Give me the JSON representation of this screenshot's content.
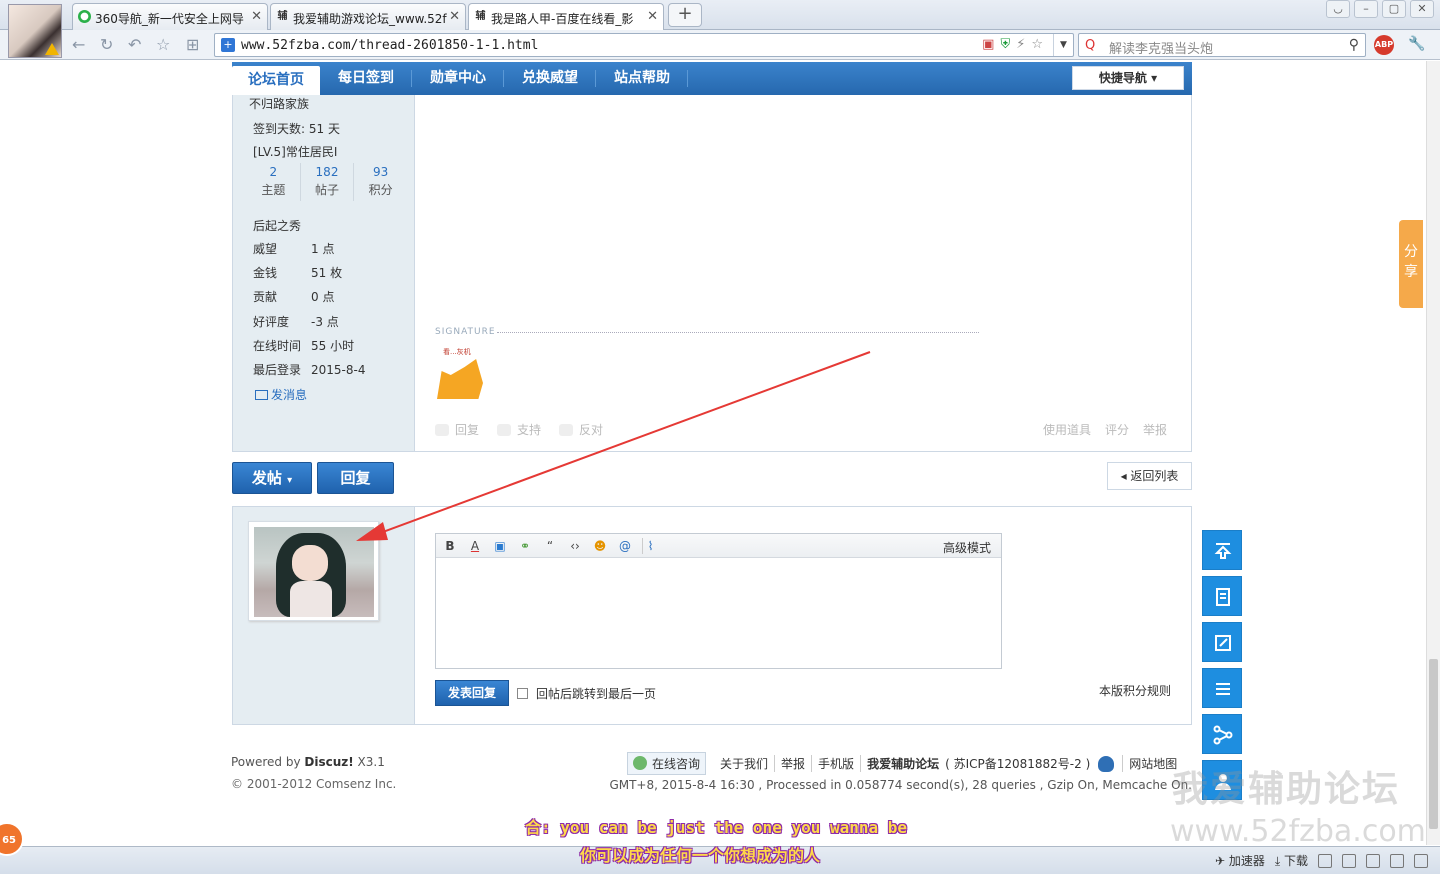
{
  "browser": {
    "tabs": [
      {
        "label": "360导航_新一代安全上网导",
        "icon": "360-icon"
      },
      {
        "label": "我爱辅助游戏论坛_www.52f",
        "icon": "site-icon"
      },
      {
        "label": "我是路人甲-百度在线看_影",
        "icon": "site-icon"
      }
    ],
    "url": "www.52fzba.com/thread-2601850-1-1.html",
    "search_placeholder": "解读李克强当头炮",
    "abp": "ABP"
  },
  "forum_nav": {
    "items": [
      "论坛首页",
      "每日签到",
      "勋章中心",
      "兑换威望",
      "站点帮助"
    ],
    "quick_nav": "快捷导航"
  },
  "profile": {
    "group": "不归路家族",
    "sign_days": "签到天数: 51 天",
    "level": "[LV.5]常住居民I",
    "stats": [
      {
        "num": "2",
        "label": "主题"
      },
      {
        "num": "182",
        "label": "帖子"
      },
      {
        "num": "93",
        "label": "积分"
      }
    ],
    "rank": "后起之秀",
    "fields": [
      {
        "k": "威望",
        "v": "1 点"
      },
      {
        "k": "金钱",
        "v": "51 枚"
      },
      {
        "k": "贡献",
        "v": "0 点"
      },
      {
        "k": "好评度",
        "v": "-3 点"
      },
      {
        "k": "在线时间",
        "v": "55 小时"
      },
      {
        "k": "最后登录",
        "v": "2015-8-4"
      }
    ],
    "send_msg": "发消息"
  },
  "post": {
    "signature_label": "SIGNATURE",
    "signature_image_text": "看...灰机",
    "actions": [
      "回复",
      "支持",
      "反对"
    ],
    "tools": [
      "使用道具",
      "评分",
      "举报"
    ]
  },
  "buttons": {
    "new_post": "发帖",
    "reply": "回复",
    "back_list": "返回列表"
  },
  "editor": {
    "advanced_mode": "高级模式",
    "submit": "发表回复",
    "jump_label": "回帖后跳转到最后一页",
    "rules": "本版积分规则"
  },
  "footer": {
    "powered_prefix": "Powered by ",
    "powered_name": "Discuz!",
    "powered_version": " X3.1",
    "copyright": "© 2001-2012 Comsenz Inc.",
    "consult": "在线咨询",
    "links": [
      "关于我们",
      "举报",
      "手机版"
    ],
    "site_name": "我爱辅助论坛",
    "icp": "( 苏ICP备12081882号-2 )",
    "sitemap": "网站地图",
    "gmt": "GMT+8, 2015-8-4 16:30 , Processed in 0.058774 second(s), 28 queries , Gzip On, Memcache On."
  },
  "side": {
    "share": "分享"
  },
  "watermark": {
    "line1": "我爱辅助论坛",
    "line2": "www.52fzba.com"
  },
  "subtitles": {
    "line1": "合: you can be just the one you wanna be",
    "line2": "你可以成为任何一个你想成为的人"
  },
  "statusbar": {
    "badge": "65",
    "accelerator": "加速器",
    "download": "下载"
  },
  "colors": {
    "forum_blue": "#2a6fbf",
    "annotation_arrow": "#e53935",
    "share_orange": "#f5a94a",
    "side_button_blue": "#1e8ee0"
  }
}
